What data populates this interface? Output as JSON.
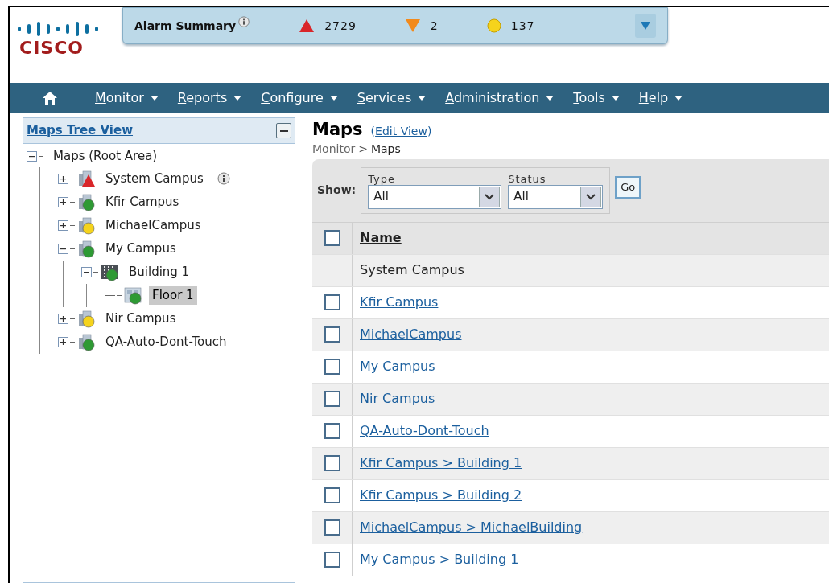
{
  "logo": {
    "text": "CISCO"
  },
  "alarm_summary": {
    "title": "Alarm Summary",
    "counts": [
      {
        "kind": "critical",
        "value": "2729"
      },
      {
        "kind": "major",
        "value": "2"
      },
      {
        "kind": "minor",
        "value": "137"
      }
    ]
  },
  "nav": [
    {
      "label": "Monitor"
    },
    {
      "label": "Reports"
    },
    {
      "label": "Configure"
    },
    {
      "label": "Services"
    },
    {
      "label": "Administration"
    },
    {
      "label": "Tools"
    },
    {
      "label": "Help"
    }
  ],
  "tree": {
    "title": "Maps Tree View",
    "root": {
      "label": "Maps (Root Area)",
      "expanded": true,
      "children": [
        {
          "label": "System Campus",
          "kind": "campus",
          "badge": {
            "kind": "triangle",
            "color": "#d9262a"
          },
          "expanded": false,
          "selected": false,
          "info": true
        },
        {
          "label": "Kfir Campus",
          "kind": "campus",
          "badge": {
            "kind": "circle",
            "color": "#2e9a34"
          },
          "expanded": false,
          "selected": false,
          "info": false
        },
        {
          "label": "MichaelCampus",
          "kind": "campus",
          "badge": {
            "kind": "circle",
            "color": "#f5d31c"
          },
          "expanded": false,
          "selected": false,
          "info": false
        },
        {
          "label": "My Campus",
          "kind": "campus",
          "badge": {
            "kind": "circle",
            "color": "#2e9a34"
          },
          "expanded": true,
          "selected": false,
          "info": false,
          "children": [
            {
              "label": "Building 1",
              "kind": "building",
              "badge": {
                "kind": "circle",
                "color": "#2e9a34"
              },
              "expanded": true,
              "selected": false,
              "info": false,
              "children": [
                {
                  "label": "Floor 1",
                  "kind": "floor",
                  "badge": {
                    "kind": "circle",
                    "color": "#2e9a34"
                  },
                  "selected": true,
                  "info": false
                }
              ]
            }
          ]
        },
        {
          "label": "Nir Campus",
          "kind": "campus",
          "badge": {
            "kind": "circle",
            "color": "#f5d31c"
          },
          "expanded": false,
          "selected": false,
          "info": false
        },
        {
          "label": "QA-Auto-Dont-Touch",
          "kind": "campus",
          "badge": {
            "kind": "circle",
            "color": "#2e9a34"
          },
          "expanded": false,
          "selected": false,
          "info": false
        }
      ]
    }
  },
  "content": {
    "title": "Maps",
    "edit_link": {
      "open": "(",
      "label": "Edit View",
      "close": ")"
    },
    "breadcrumb": [
      {
        "label": "Monitor",
        "current": false
      },
      {
        "label": "Maps",
        "current": true
      }
    ],
    "separator": ">",
    "filters": {
      "show_label": "Show:",
      "fields": [
        {
          "label": "Type",
          "value": "All"
        },
        {
          "label": "Status",
          "value": "All"
        }
      ],
      "go": "Go"
    },
    "table": {
      "column": "Name",
      "all_checked": false,
      "rows": [
        {
          "name": "System Campus",
          "kind": "group"
        },
        {
          "name": "Kfir Campus",
          "kind": "item",
          "checked": false
        },
        {
          "name": "MichaelCampus",
          "kind": "item",
          "checked": false
        },
        {
          "name": "My Campus",
          "kind": "item",
          "checked": false
        },
        {
          "name": "Nir Campus",
          "kind": "item",
          "checked": false
        },
        {
          "name": "QA-Auto-Dont-Touch",
          "kind": "item",
          "checked": false
        },
        {
          "name": "Kfir Campus > Building 1",
          "kind": "item",
          "checked": false
        },
        {
          "name": "Kfir Campus > Building 2",
          "kind": "item",
          "checked": false
        },
        {
          "name": "MichaelCampus > MichaelBuilding",
          "kind": "item",
          "checked": false
        },
        {
          "name": "My Campus > Building 1",
          "kind": "item",
          "checked": false
        }
      ]
    }
  }
}
